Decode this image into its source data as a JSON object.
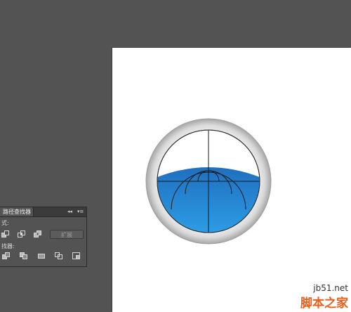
{
  "panel": {
    "tab_label": "路径查找器",
    "collapse_glyph": "◂◂",
    "menu_glyph": "▾≡",
    "shape_modes_label": "式:",
    "pathfinders_label": "找器:",
    "expand_label": "扩展"
  },
  "watermark": {
    "url": "jb51.net",
    "site": "脚本之家"
  },
  "colors": {
    "workspace": "#535353",
    "artboard": "#ffffff",
    "ring_outer": "#9a9a9a",
    "ring_inner": "#e2e2e2",
    "water_top": "#1f6fbf",
    "water_bottom": "#2ea0e8",
    "watermark_accent": "#e8601c"
  }
}
